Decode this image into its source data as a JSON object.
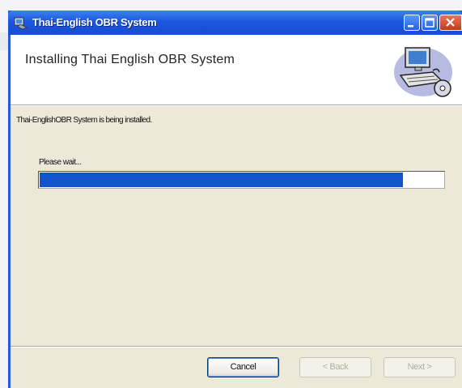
{
  "window": {
    "title": "Thai-English OBR System",
    "accent_color": "#1c57e0"
  },
  "titlebar_buttons": {
    "minimize_icon": "minimize-icon",
    "maximize_icon": "maximize-icon",
    "close_icon": "close-icon"
  },
  "header": {
    "title": "Installing Thai English OBR System",
    "graphic_icon": "computer-installer-icon"
  },
  "body": {
    "status_text": "Thai-EnglishOBR System is being installed.",
    "wait_label": "Please wait...",
    "progress_fraction": 0.9
  },
  "buttons": {
    "cancel": "Cancel",
    "back": "< Back",
    "next": "Next >"
  }
}
